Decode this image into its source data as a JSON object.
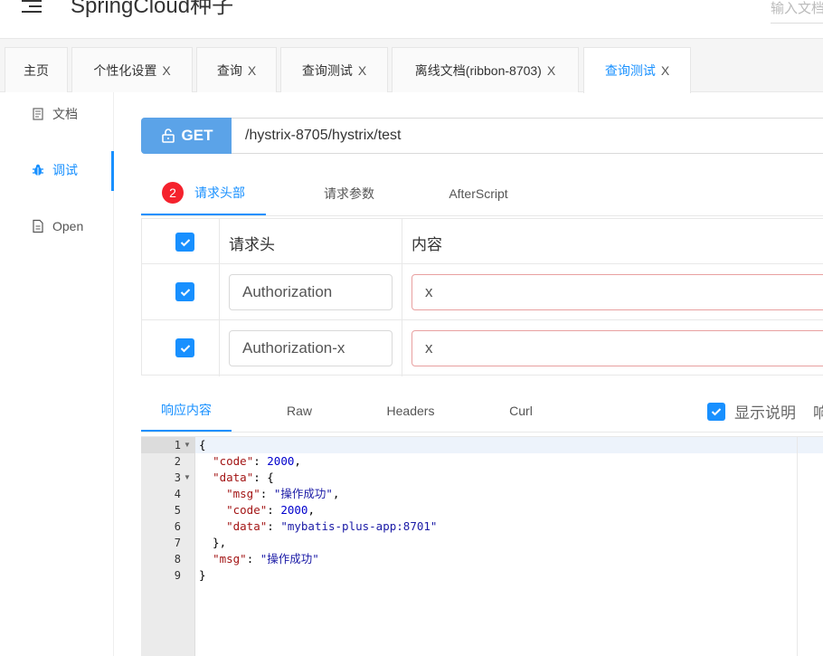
{
  "header": {
    "title": "SpringCloud种子",
    "search_placeholder": "输入文档"
  },
  "tabs": [
    {
      "label": "主页",
      "closable": false
    },
    {
      "label": "个性化设置",
      "closable": true
    },
    {
      "label": "查询",
      "closable": true
    },
    {
      "label": "查询测试",
      "closable": true
    },
    {
      "label": "离线文档(ribbon-8703)",
      "closable": true
    },
    {
      "label": "查询测试",
      "closable": true,
      "active": true
    }
  ],
  "tab_close": "X",
  "sidebar": {
    "items": [
      {
        "label": "文档",
        "icon": "document-icon"
      },
      {
        "label": "调试",
        "icon": "bug-icon",
        "active": true
      },
      {
        "label": "Open",
        "icon": "file-icon"
      }
    ]
  },
  "request": {
    "method": "GET",
    "url": "/hystrix-8705/hystrix/test",
    "tabs": {
      "headers_badge": "2",
      "headers": "请求头部",
      "params": "请求参数",
      "after_script": "AfterScript"
    },
    "table": {
      "col_name": "请求头",
      "col_value": "内容",
      "rows": [
        {
          "name": "Authorization",
          "value": "x",
          "checked": true
        },
        {
          "name": "Authorization-x",
          "value": "x",
          "checked": true
        }
      ]
    }
  },
  "response": {
    "tabs": {
      "content": "响应内容",
      "raw": "Raw",
      "headers": "Headers",
      "curl": "Curl"
    },
    "show_desc": "显示说明",
    "extra": "响",
    "lines": [
      "1",
      "2",
      "3",
      "4",
      "5",
      "6",
      "7",
      "8",
      "9"
    ]
  },
  "colors": {
    "accent": "#1890ff",
    "method": "#5ba3e8",
    "badge": "#f5222d"
  }
}
